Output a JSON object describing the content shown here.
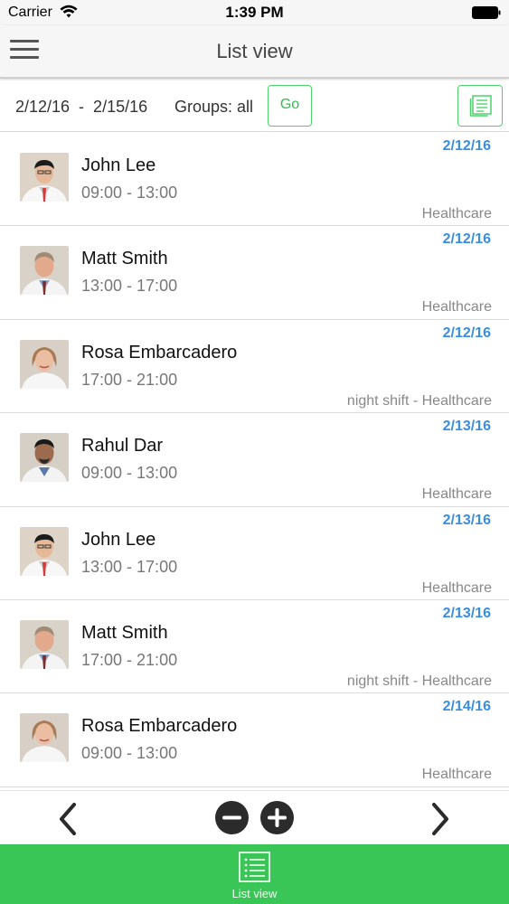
{
  "status_bar": {
    "carrier": "Carrier",
    "time": "1:39 PM",
    "icons": [
      "wifi-icon",
      "battery-icon"
    ]
  },
  "nav_bar": {
    "title": "List view",
    "menu_icon": "hamburger-menu-icon"
  },
  "filter": {
    "date_range": "2/12/16  -  2/15/16",
    "groups_label": "Groups: all",
    "go_label": "Go",
    "report_icon": "report-list-icon",
    "accent_color": "#4cd46a"
  },
  "shifts": [
    {
      "name": "John Lee",
      "time": "09:00 - 13:00",
      "date": "2/12/16",
      "group": "Healthcare"
    },
    {
      "name": "Matt Smith",
      "time": "13:00 - 17:00",
      "date": "2/12/16",
      "group": "Healthcare"
    },
    {
      "name": "Rosa Embarcadero",
      "time": "17:00 - 21:00",
      "date": "2/12/16",
      "group": "night shift - Healthcare"
    },
    {
      "name": "Rahul Dar",
      "time": "09:00 - 13:00",
      "date": "2/13/16",
      "group": "Healthcare"
    },
    {
      "name": "John Lee",
      "time": "13:00 - 17:00",
      "date": "2/13/16",
      "group": "Healthcare"
    },
    {
      "name": "Matt Smith",
      "time": "17:00 - 21:00",
      "date": "2/13/16",
      "group": "night shift - Healthcare"
    },
    {
      "name": "Rosa Embarcadero",
      "time": "09:00 - 13:00",
      "date": "2/14/16",
      "group": "Healthcare"
    }
  ],
  "pager": {
    "icons": [
      "chevron-left-icon",
      "minus-circle-icon",
      "plus-circle-icon",
      "chevron-right-icon"
    ]
  },
  "tab_bar": {
    "label": "List view",
    "icon": "list-icon",
    "color": "#39c657"
  },
  "colors": {
    "date_blue": "#3a8ee0",
    "muted_gray": "#888888"
  }
}
